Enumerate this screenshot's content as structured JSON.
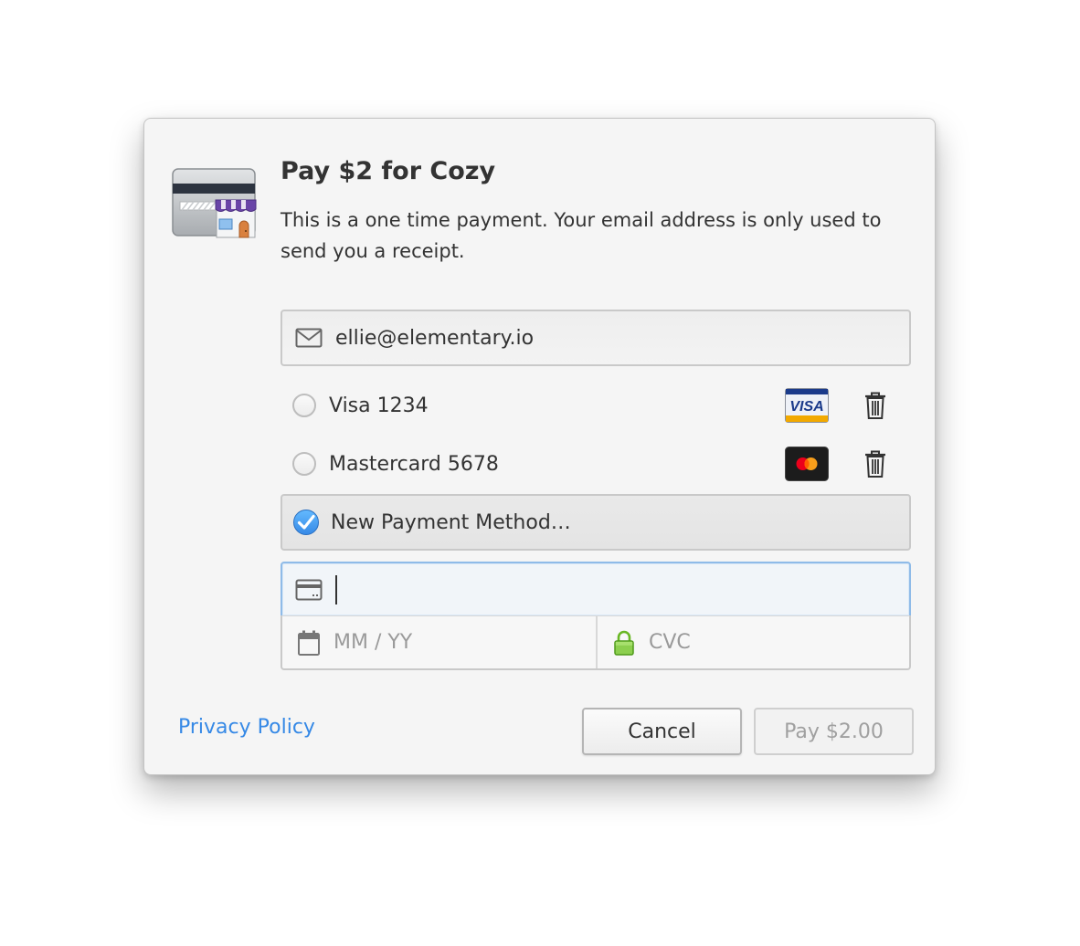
{
  "dialog": {
    "title": "Pay $2 for Cozy",
    "description": "This is a one time payment. Your email address is only used to send you a receipt."
  },
  "email": {
    "value": "ellie@elementary.io",
    "icon": "mail-icon"
  },
  "payment_methods": [
    {
      "label": "Visa 1234",
      "brand": "visa",
      "selected": false
    },
    {
      "label": "Mastercard 5678",
      "brand": "mastercard",
      "selected": false
    }
  ],
  "new_payment": {
    "label": "New Payment Method…",
    "selected": true
  },
  "card_form": {
    "number_value": "",
    "expiry_placeholder": "MM / YY",
    "cvc_placeholder": "CVC"
  },
  "footer": {
    "privacy_label": "Privacy Policy",
    "cancel_label": "Cancel",
    "pay_label": "Pay $2.00"
  },
  "colors": {
    "accent": "#3689e6",
    "secure": "#68b723",
    "focus_border": "#8fbbe8"
  }
}
